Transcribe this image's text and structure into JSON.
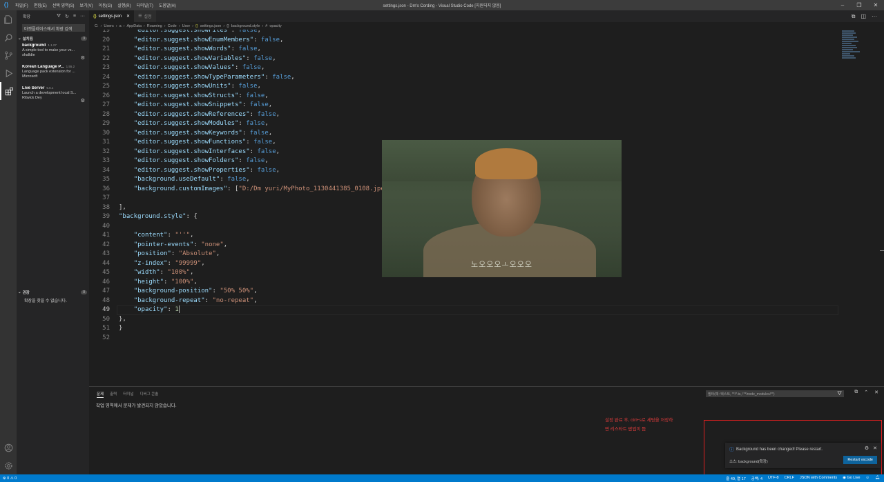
{
  "window": {
    "title": "settings.json - Dm's Cording - Visual Studio Code [지원되지 않음]",
    "menu": [
      "파일(F)",
      "편집(E)",
      "선택 영역(S)",
      "보기(V)",
      "이동(G)",
      "실행(R)",
      "터미널(T)",
      "도움말(H)"
    ],
    "controls": [
      "–",
      "❐",
      "✕"
    ]
  },
  "sidebar": {
    "title": "확장",
    "search_placeholder": "마켓플레이스에서 확장 검색",
    "installed": {
      "label": "설치됨",
      "count": "3",
      "items": [
        {
          "name": "background",
          "version": "1.1.27",
          "description": "A simple tool to make your vs...",
          "publisher": "shalldie"
        },
        {
          "name": "Korean Language P...",
          "version": "1.55.2",
          "description": "Language pack extension for ...",
          "publisher": "Microsoft"
        },
        {
          "name": "Live Server",
          "version": "5.6.1",
          "description": "Launch a development local S...",
          "publisher": "Ritwick Dey"
        }
      ]
    },
    "recommended": {
      "label": "권장",
      "count": "0",
      "message": "확장을 찾을 수 없습니다."
    }
  },
  "tabs": [
    {
      "label": "settings.json",
      "active": true
    },
    {
      "label": "설정",
      "active": false
    }
  ],
  "breadcrumb": [
    "C:",
    "Users",
    "a",
    "AppData",
    "Roaming",
    "Code",
    "User",
    "settings.json",
    "background.style",
    "opacity"
  ],
  "editor": {
    "current_line": 49,
    "lines": [
      {
        "n": "19",
        "t": "    \"editor.suggest.showFiles\": false,"
      },
      {
        "n": "20",
        "t": "    \"editor.suggest.showEnumMembers\": false,"
      },
      {
        "n": "21",
        "t": "    \"editor.suggest.showWords\": false,"
      },
      {
        "n": "22",
        "t": "    \"editor.suggest.showVariables\": false,"
      },
      {
        "n": "23",
        "t": "    \"editor.suggest.showValues\": false,"
      },
      {
        "n": "24",
        "t": "    \"editor.suggest.showTypeParameters\": false,"
      },
      {
        "n": "25",
        "t": "    \"editor.suggest.showUnits\": false,"
      },
      {
        "n": "26",
        "t": "    \"editor.suggest.showStructs\": false,"
      },
      {
        "n": "27",
        "t": "    \"editor.suggest.showSnippets\": false,"
      },
      {
        "n": "28",
        "t": "    \"editor.suggest.showReferences\": false,"
      },
      {
        "n": "29",
        "t": "    \"editor.suggest.showModules\": false,"
      },
      {
        "n": "30",
        "t": "    \"editor.suggest.showKeywords\": false,"
      },
      {
        "n": "31",
        "t": "    \"editor.suggest.showFunctions\": false,"
      },
      {
        "n": "32",
        "t": "    \"editor.suggest.showInterfaces\": false,"
      },
      {
        "n": "33",
        "t": "    \"editor.suggest.showFolders\": false,"
      },
      {
        "n": "34",
        "t": "    \"editor.suggest.showProperties\": false,"
      },
      {
        "n": "35",
        "t": "    \"background.useDefault\": false,"
      },
      {
        "n": "36",
        "t": "    \"background.customImages\": [\"D:/Dm yuri/MyPhoto_1130441385_0108.jpeg\""
      },
      {
        "n": "37",
        "t": ""
      },
      {
        "n": "38",
        "t": "],"
      },
      {
        "n": "39",
        "t": "\"background.style\": {"
      },
      {
        "n": "40",
        "t": ""
      },
      {
        "n": "41",
        "t": "    \"content\": \"''\","
      },
      {
        "n": "42",
        "t": "    \"pointer-events\": \"none\","
      },
      {
        "n": "43",
        "t": "    \"position\": \"Absolute\","
      },
      {
        "n": "44",
        "t": "    \"z-index\": \"99999\","
      },
      {
        "n": "45",
        "t": "    \"width\": \"100%\","
      },
      {
        "n": "46",
        "t": "    \"height\": \"100%\","
      },
      {
        "n": "47",
        "t": "    \"background-position\": \"50% 50%\","
      },
      {
        "n": "48",
        "t": "    \"background-repeat\": \"no-repeat\","
      },
      {
        "n": "49",
        "t": "    \"opacity\": 1"
      },
      {
        "n": "50",
        "t": "},"
      },
      {
        "n": "51",
        "t": "}"
      },
      {
        "n": "52",
        "t": ""
      }
    ],
    "background_caption": "노오오오ㅗ오오오"
  },
  "panel": {
    "tabs": [
      "문제",
      "출력",
      "터미널",
      "디버그 콘솔"
    ],
    "message": "작업 영역에서 문제가 발견되지 않았습니다.",
    "filter_placeholder": "필터(예: 텍스트, **/*.ts, !**/node_modules/**)"
  },
  "annotation": [
    "설정 완료 후, ctrl+s로 세팅을 저장하",
    "면 리스타트 팝업이 뜸"
  ],
  "notification": {
    "message": "Background has been changed! Please restart.",
    "source": "소스: background(확장)",
    "button": "Restart vscode"
  },
  "statusbar": {
    "problems": "⊗ 0  ⚠ 0",
    "position": "줄 49, 열 17",
    "spaces": "공백: 4",
    "encoding": "UTF-8",
    "eol": "CRLF",
    "language": "JSON with Comments",
    "golive": "Go Live"
  },
  "colors": {
    "accent": "#007acc",
    "annotation": "#e03c3c",
    "button": "#0e639c"
  }
}
